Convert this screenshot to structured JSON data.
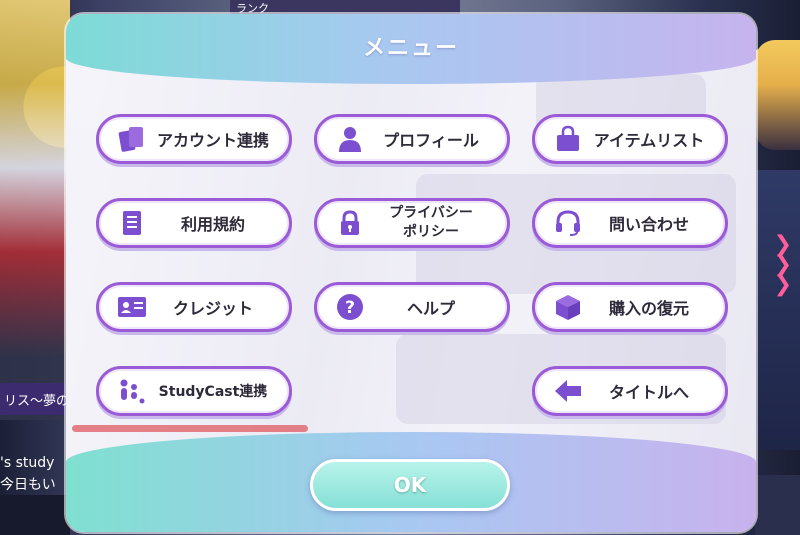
{
  "background": {
    "top_strip_text": "ランク",
    "banner_text": "リス〜夢の",
    "text_lines": [
      "'s study",
      "今日もい"
    ]
  },
  "dialog": {
    "title": "メニュー",
    "buttons": [
      {
        "label": "アカウント連携",
        "icon": "cards-icon"
      },
      {
        "label": "プロフィール",
        "icon": "person-icon"
      },
      {
        "label": "アイテムリスト",
        "icon": "bag-icon"
      },
      {
        "label": "利用規約",
        "icon": "document-icon"
      },
      {
        "label": "プライバシー\nポリシー",
        "icon": "lock-icon"
      },
      {
        "label": "問い合わせ",
        "icon": "headset-icon"
      },
      {
        "label": "クレジット",
        "icon": "id-card-icon"
      },
      {
        "label": "ヘルプ",
        "icon": "question-icon"
      },
      {
        "label": "購入の復元",
        "icon": "box-icon"
      },
      {
        "label": "StudyCast連携",
        "icon": "studycast-icon"
      },
      {
        "label": "タイトルへ",
        "icon": "arrow-left-icon"
      }
    ],
    "ok_label": "OK"
  },
  "colors": {
    "accent_purple": "#9b5bd6",
    "header_teal": "#7ddbd6",
    "annotation_red": "#e06b73"
  }
}
